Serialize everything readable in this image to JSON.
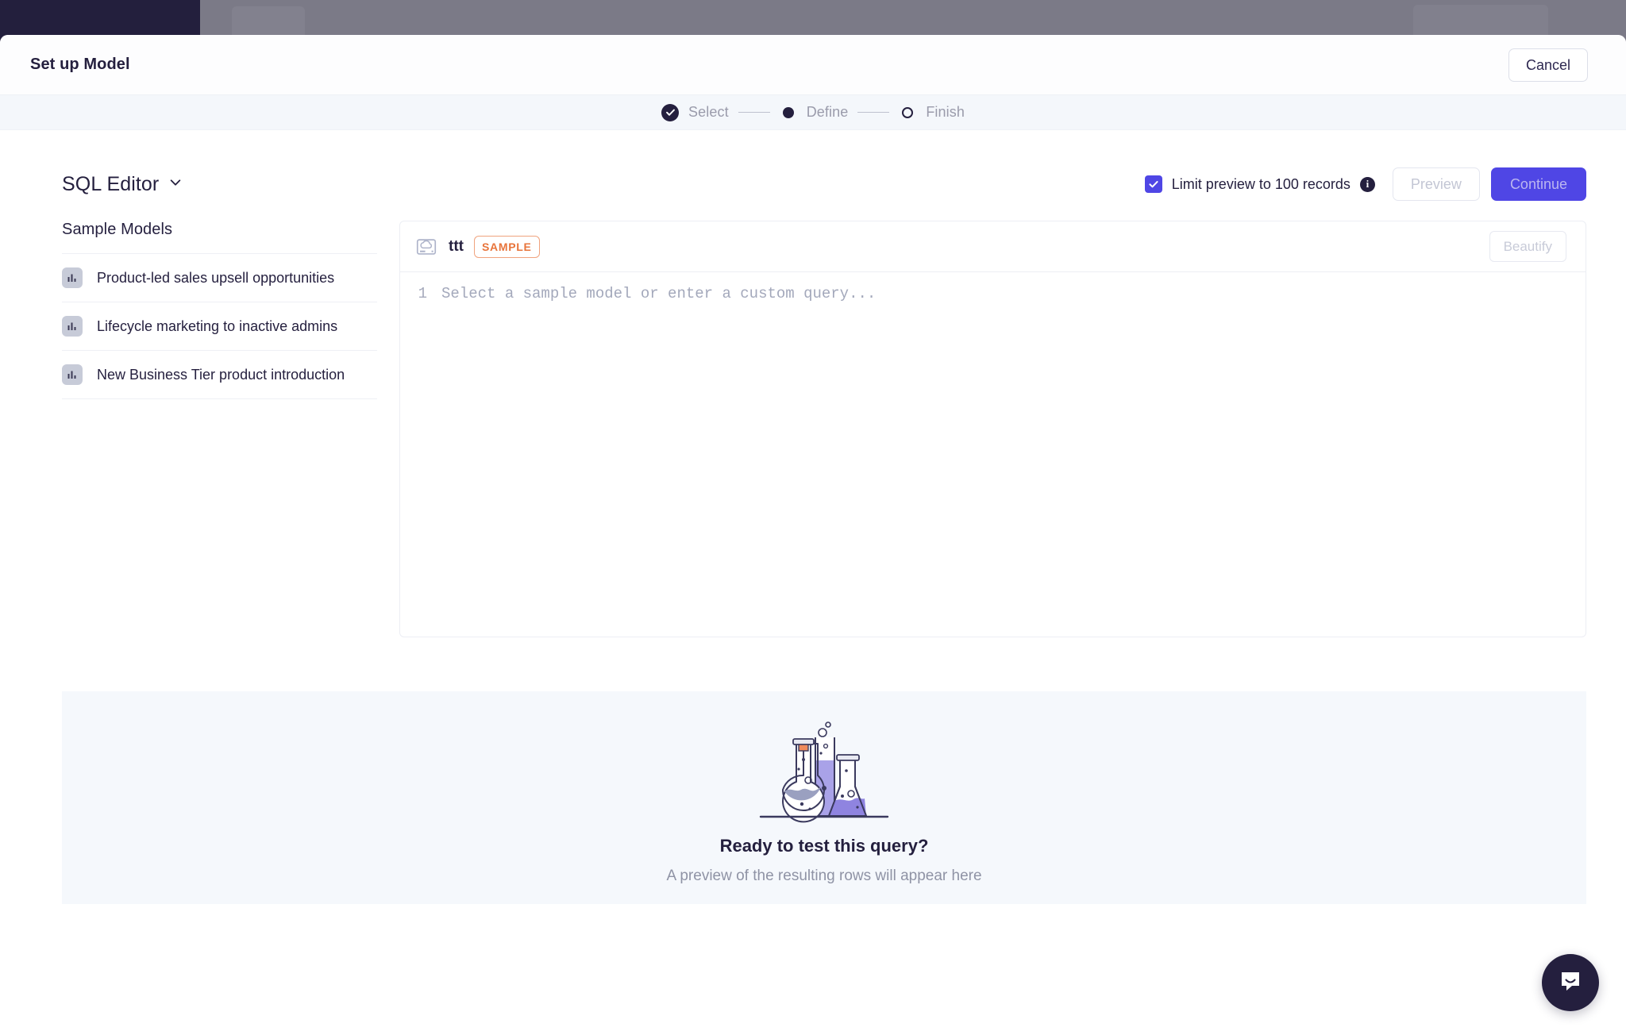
{
  "modal": {
    "title": "Set up Model",
    "cancel_label": "Cancel"
  },
  "stepper": {
    "steps": [
      {
        "label": "Select",
        "state": "done"
      },
      {
        "label": "Define",
        "state": "current"
      },
      {
        "label": "Finish",
        "state": "todo"
      }
    ]
  },
  "toolbar": {
    "editor_mode_label": "SQL Editor",
    "limit_preview_label": "Limit preview to 100 records",
    "limit_preview_checked": true,
    "info_glyph": "i",
    "preview_label": "Preview",
    "continue_label": "Continue"
  },
  "sidebar": {
    "title": "Sample Models",
    "items": [
      {
        "label": "Product-led sales upsell opportunities",
        "icon": "bar-chart-icon"
      },
      {
        "label": "Lifecycle marketing to inactive admins",
        "icon": "bar-chart-icon"
      },
      {
        "label": "New Business Tier product introduction",
        "icon": "bar-chart-icon"
      }
    ]
  },
  "editor": {
    "source_name": "ttt",
    "source_icon": "cloud-warehouse-icon",
    "badge_label": "SAMPLE",
    "beautify_label": "Beautify",
    "line_number": "1",
    "placeholder": "Select a sample model or enter a custom query..."
  },
  "preview": {
    "illustration": "lab-flasks-illustration",
    "title": "Ready to test this query?",
    "subtitle": "A preview of the resulting rows will appear here"
  },
  "support": {
    "launcher_icon": "chat-bubble-icon"
  },
  "colors": {
    "accent": "#4f46e5",
    "dark": "#241f3e",
    "badge": "#e8743b",
    "panel_bg": "#f5f8fc",
    "overlay": "#7b7a87"
  }
}
